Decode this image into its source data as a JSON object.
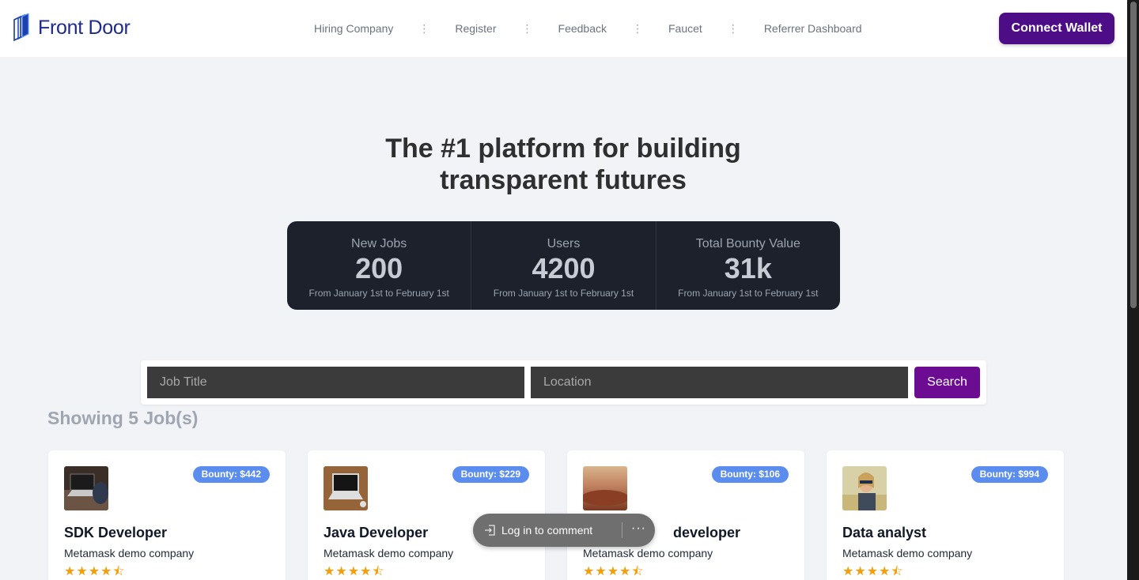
{
  "header": {
    "logo_text": "Front Door",
    "nav": [
      "Hiring Company",
      "Register",
      "Feedback",
      "Faucet",
      "Referrer Dashboard"
    ],
    "connect_label": "Connect Wallet"
  },
  "hero": {
    "title_line1": "The #1 platform for building",
    "title_line2": "transparent futures"
  },
  "stats": [
    {
      "label": "New Jobs",
      "value": "200",
      "desc": "From January 1st to February 1st"
    },
    {
      "label": "Users",
      "value": "4200",
      "desc": "From January 1st to February 1st"
    },
    {
      "label": "Total Bounty Value",
      "value": "31k",
      "desc": "From January 1st to February 1st"
    }
  ],
  "search": {
    "job_placeholder": "Job Title",
    "location_placeholder": "Location",
    "button_label": "Search"
  },
  "results": {
    "showing_label": "Showing 5 Job(s)"
  },
  "jobs": [
    {
      "title": "SDK Developer",
      "company": "Metamask demo company",
      "bounty": "Bounty: $442",
      "stars": "★★★★⯪",
      "thumb": "laptop-hands"
    },
    {
      "title": "Java Developer",
      "company": "Metamask demo company",
      "bounty": "Bounty: $229",
      "stars": "★★★★⯪",
      "thumb": "laptop-desk"
    },
    {
      "title": "developer",
      "company": "Metamask demo company",
      "bounty": "Bounty: $106",
      "stars": "★★★★⯪",
      "thumb": "desert"
    },
    {
      "title": "Data analyst",
      "company": "Metamask demo company",
      "bounty": "Bounty: $994",
      "stars": "★★★★⯪",
      "thumb": "person-field"
    }
  ],
  "comment_pill": {
    "label": "Log in to comment",
    "more": "···"
  },
  "colors": {
    "brand": "#4c0d87",
    "search_button": "#6b0c92",
    "bounty_badge": "#5b8def",
    "stats_bg": "#1c212b",
    "stars": "#f59e0b"
  }
}
